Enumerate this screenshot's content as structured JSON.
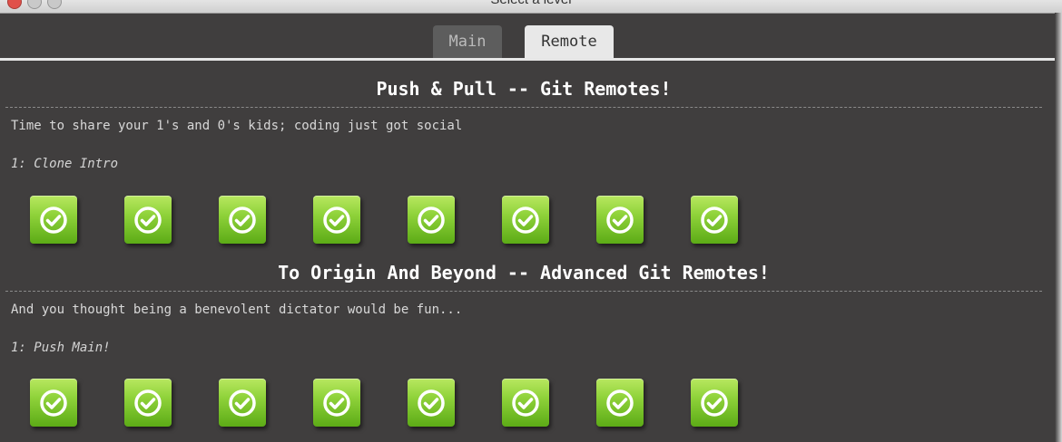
{
  "window": {
    "title": "Select a level"
  },
  "tabs": [
    {
      "label": "Main",
      "selected": false
    },
    {
      "label": "Remote",
      "selected": true
    }
  ],
  "sections": [
    {
      "title": "Push & Pull -- Git Remotes!",
      "subtitle": "Time to share your 1's and 0's kids; coding just got social",
      "selected_level": "1: Clone Intro",
      "levels_completed": [
        true,
        true,
        true,
        true,
        true,
        true,
        true,
        true
      ]
    },
    {
      "title": "To Origin And Beyond -- Advanced Git Remotes!",
      "subtitle": "And you thought being a benevolent dictator would be fun...",
      "selected_level": "1: Push Main!",
      "levels_completed": [
        true,
        true,
        true,
        true,
        true,
        true,
        true,
        true
      ]
    }
  ],
  "colors": {
    "background": "#403e3e",
    "level_button": "#8fd23a",
    "text": "#ffffff"
  },
  "icons": {
    "level": "checkmark-circle-icon"
  }
}
